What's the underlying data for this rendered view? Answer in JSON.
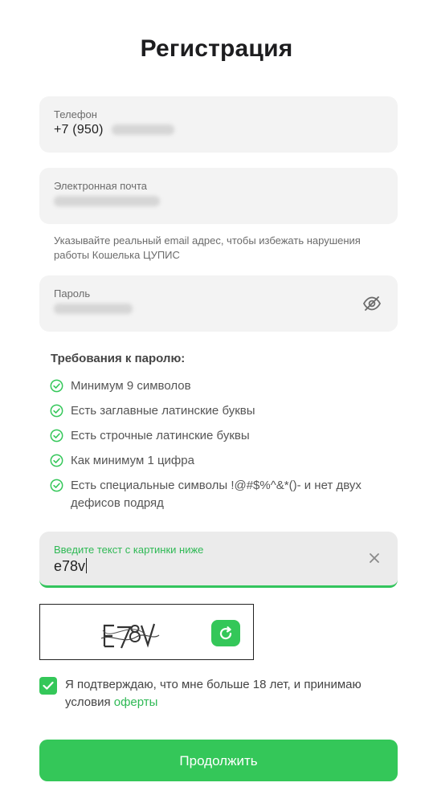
{
  "page": {
    "title": "Регистрация"
  },
  "form": {
    "phone": {
      "label": "Телефон",
      "value": "+7 (950)"
    },
    "email": {
      "label": "Электронная почта",
      "hint": "Указывайте реальный email адрес, чтобы избежать нарушения работы Кошелька ЦУПИС"
    },
    "password": {
      "label": "Пароль",
      "toggle_icon": "eye-crossed-icon"
    },
    "requirements": {
      "title": "Требования к паролю:",
      "items": [
        "Минимум 9 символов",
        "Есть заглавные латинские буквы",
        "Есть строчные латинские буквы",
        "Как минимум 1 цифра",
        "Есть специальные символы !@#$%^&*()- и нет двух дефисов подряд"
      ]
    },
    "captcha": {
      "label": "Введите текст с картинки ниже",
      "value": "e78v",
      "clear_icon": "close-icon",
      "refresh_icon": "refresh-icon"
    },
    "consent": {
      "checked": true,
      "text": "Я подтверждаю, что мне больше 18 лет, и принимаю условия ",
      "link_text": "оферты"
    },
    "submit": {
      "label": "Продолжить"
    }
  },
  "colors": {
    "accent": "#34c759",
    "field_bg": "#f3f3f3",
    "text_muted": "#6b6b6b"
  }
}
